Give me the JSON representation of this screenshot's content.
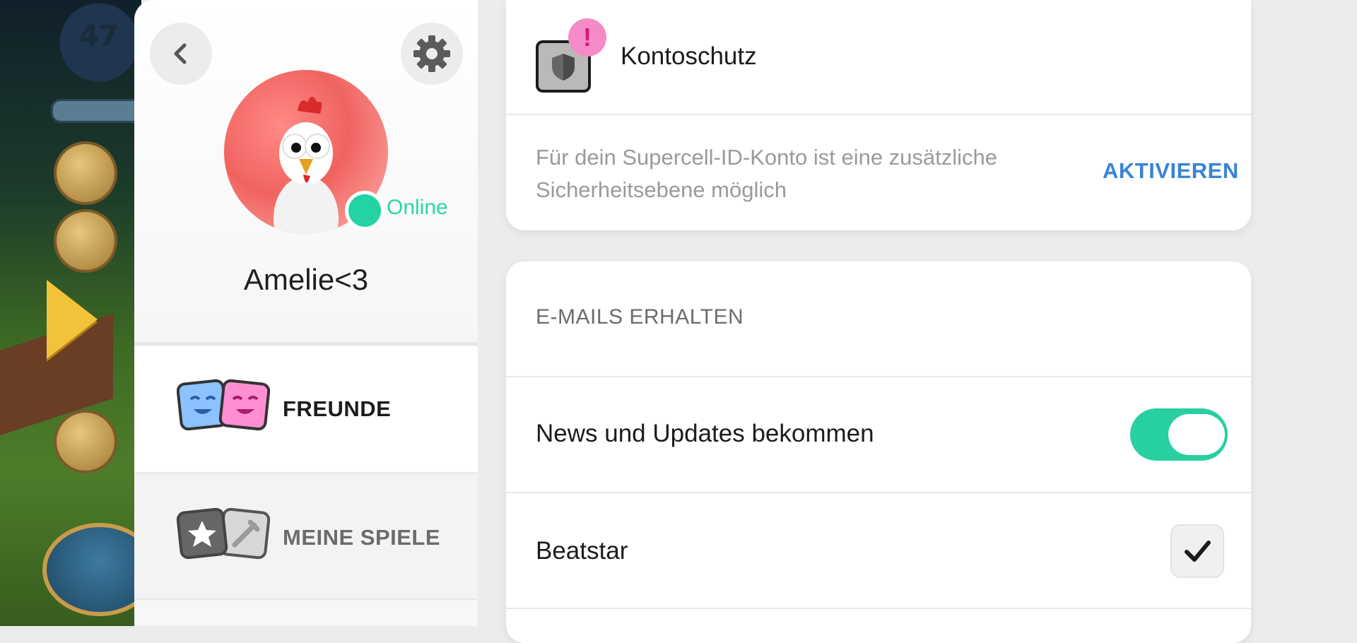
{
  "game": {
    "level": "47"
  },
  "profile": {
    "status": "Online",
    "username": "Amelie<3"
  },
  "tabs": [
    {
      "label": "FREUNDE",
      "selected": true
    },
    {
      "label": "MEINE SPIELE",
      "selected": false
    }
  ],
  "security": {
    "title": "Kontoschutz",
    "badge": "!",
    "description": "Für dein Supercell-ID-Konto ist eine zusätzliche Sicherheitsebene möglich",
    "action_label": "AKTIVIEREN"
  },
  "emails": {
    "heading": "E-MAILS ERHALTEN",
    "news_label": "News und Updates bekommen",
    "news_enabled": true,
    "games": [
      {
        "label": "Beatstar",
        "checked": true
      }
    ]
  },
  "colors": {
    "accent_green": "#27cfa1",
    "link_blue": "#3a83d6",
    "alert_pink": "#f58bc6"
  }
}
